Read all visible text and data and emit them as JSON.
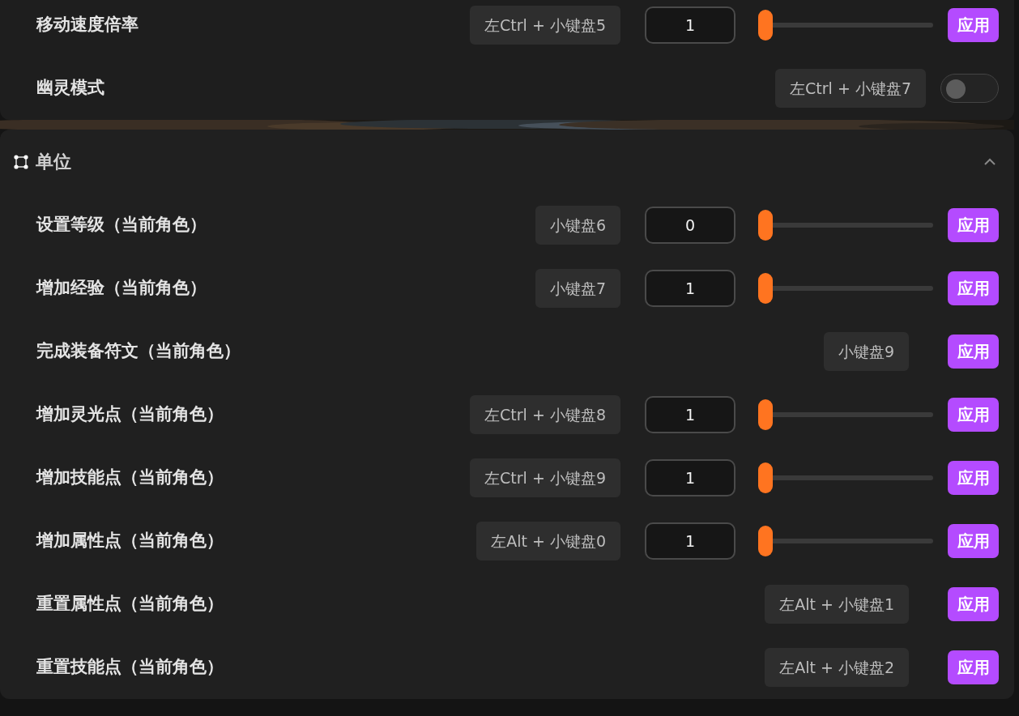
{
  "sections": [
    {
      "rows": [
        {
          "kind": "slider",
          "label": "移动速度倍率",
          "hotkey": "左Ctrl + 小键盘5",
          "value": "1",
          "level": 0,
          "action": "应用"
        },
        {
          "kind": "toggle",
          "label": "幽灵模式",
          "hotkey": "左Ctrl + 小键盘7",
          "on": false
        }
      ]
    },
    {
      "title": "单位",
      "expanded": true,
      "rows": [
        {
          "kind": "slider",
          "label": "设置等级（当前角色）",
          "hotkey": "小键盘6",
          "value": "0",
          "level": 0,
          "action": "应用"
        },
        {
          "kind": "slider",
          "label": "增加经验（当前角色）",
          "hotkey": "小键盘7",
          "value": "1",
          "level": 0,
          "action": "应用"
        },
        {
          "kind": "button",
          "label": "完成装备符文（当前角色）",
          "hotkey": "小键盘9",
          "action": "应用"
        },
        {
          "kind": "slider",
          "label": "增加灵光点（当前角色）",
          "hotkey": "左Ctrl + 小键盘8",
          "value": "1",
          "level": 0,
          "action": "应用"
        },
        {
          "kind": "slider",
          "label": "增加技能点（当前角色）",
          "hotkey": "左Ctrl + 小键盘9",
          "value": "1",
          "level": 0,
          "action": "应用"
        },
        {
          "kind": "slider",
          "label": "增加属性点（当前角色）",
          "hotkey": "左Alt + 小键盘0",
          "value": "1",
          "level": 0,
          "action": "应用"
        },
        {
          "kind": "button",
          "label": "重置属性点（当前角色）",
          "hotkey": "左Alt + 小键盘1",
          "action": "应用"
        },
        {
          "kind": "button",
          "label": "重置技能点（当前角色）",
          "hotkey": "左Alt + 小键盘2",
          "action": "应用"
        }
      ]
    }
  ]
}
